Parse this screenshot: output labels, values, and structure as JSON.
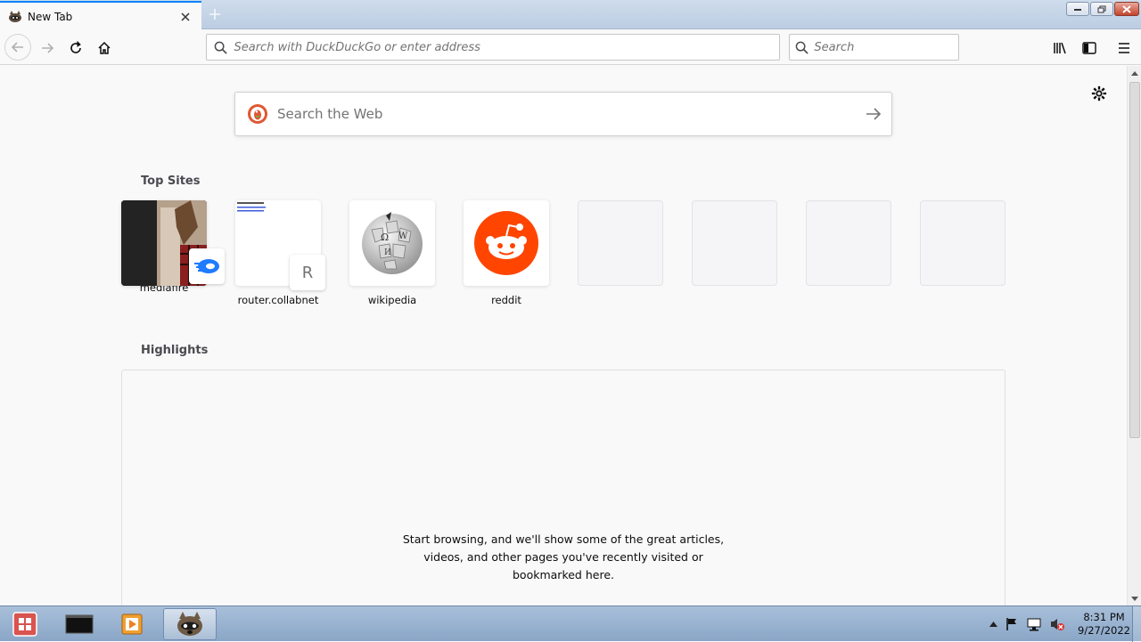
{
  "browser": {
    "tab": {
      "title": "New Tab",
      "favicon": "raccoon-icon"
    },
    "urlbar": {
      "placeholder": "Search with DuckDuckGo or enter address"
    },
    "searchbar": {
      "placeholder": "Search"
    }
  },
  "newtab": {
    "web_search": {
      "placeholder": "Search the Web",
      "engine_icon": "duckduckgo-icon"
    },
    "top_sites": {
      "title": "Top Sites",
      "items": [
        {
          "label": "mediafire",
          "badge": "mediafire-icon"
        },
        {
          "label": "router.collabnet",
          "letter": "R"
        },
        {
          "label": "wikipedia",
          "icon": "wikipedia-globe-icon"
        },
        {
          "label": "reddit",
          "icon": "reddit-icon"
        },
        {
          "label": ""
        },
        {
          "label": ""
        },
        {
          "label": ""
        },
        {
          "label": ""
        }
      ]
    },
    "highlights": {
      "title": "Highlights",
      "empty_message": [
        "Start browsing, and we'll show some of the great articles,",
        "videos, and other pages you've recently visited or",
        "bookmarked here."
      ]
    }
  },
  "taskbar": {
    "clock": {
      "time": "8:31 PM",
      "date": "9/27/2022"
    },
    "apps": [
      "start-button",
      "terminal-icon",
      "media-player-icon",
      "firefox-raccoon-icon"
    ]
  },
  "colors": {
    "accent": "#0a84ff",
    "reddit": "#ff4500",
    "mediafire": "#1f7bff"
  }
}
